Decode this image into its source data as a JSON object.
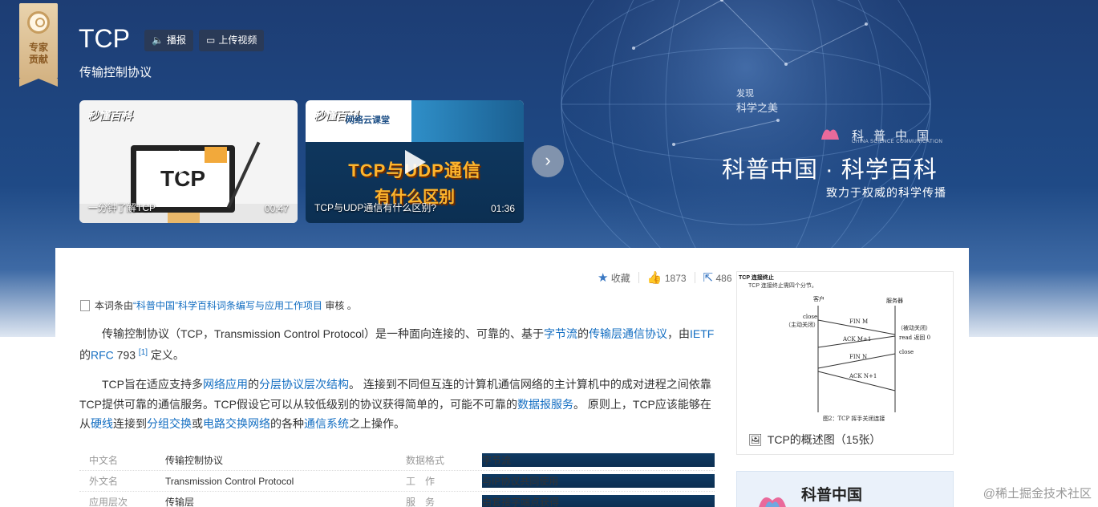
{
  "header": {
    "badge_line1": "专家",
    "badge_line2": "贡献",
    "title": "TCP",
    "play_label": "播报",
    "upload_label": "上传视频",
    "subtitle": "传输控制协议"
  },
  "videos": [
    {
      "brand": "秒懂百科",
      "screen_text": "TCP",
      "caption": "一分钟了解TCP",
      "duration": "00:47"
    },
    {
      "brand": "秒懂百科",
      "sub_brand": "网络云课堂",
      "overlay_line1": "TCP与UDP通信",
      "overlay_line2": "有什么区别",
      "caption": "TCP与UDP通信有什么区别?",
      "duration": "01:36"
    }
  ],
  "promo_banner": {
    "tag1": "发现",
    "tag2": "科学之美",
    "logo_cn": "科普中国",
    "logo_en": "CHINA SCIENCE COMMUNICATION",
    "main": "科普中国 · 科学百科",
    "sub": "致力于权威的科学传播"
  },
  "actions": {
    "collect_label": "收藏",
    "likes": "1873",
    "shares": "486"
  },
  "notice": {
    "prefix": "本词条由",
    "link": "“科普中国”科学百科词条编写与应用工作项目",
    "suffix": "审核 。"
  },
  "paragraphs": {
    "p1_a": "传输控制协议（TCP，Transmission Control Protocol）是一种面向连接的、可靠的、基于",
    "p1_link1": "字节流",
    "p1_b": "的",
    "p1_link2": "传输层通信协议",
    "p1_c": "，由",
    "p1_link3": "IETF",
    "p1_d": "的",
    "p1_link4": "RFC",
    "p1_e": " 793 ",
    "p1_ref": "[1]",
    "p1_f": " 定义。",
    "p2_a": "TCP旨在适应支持多",
    "p2_link1": "网络应用",
    "p2_b": "的",
    "p2_link2": "分层协议层次结构",
    "p2_c": "。 连接到不同但互连的计算机通信网络的主计算机中的成对进程之间依靠TCP提供可靠的通信服务。TCP假设它可以从较低级别的协议获得简单的，可能不可靠的",
    "p2_link3": "数据报服务",
    "p2_d": "。 原则上，TCP应该能够在从",
    "p2_link4": "硬线",
    "p2_e": "连接到",
    "p2_link5": "分组交换",
    "p2_f": "或",
    "p2_link6": "电路交换网络",
    "p2_g": "的各种",
    "p2_link7": "通信系统",
    "p2_h": "之上操作。"
  },
  "info_rows": [
    {
      "k": "中文名",
      "v": "传输控制协议",
      "k2": "数据格式",
      "v2": "字节流"
    },
    {
      "k": "外文名",
      "v": "Transmission Control Protocol",
      "k2": "工　作",
      "v2": "与IP协议共同使用"
    },
    {
      "k": "应用层次",
      "v": "传输层",
      "k2": "服　务",
      "v2": "由套接字端点获得"
    }
  ],
  "figure": {
    "title": "TCP 连接终止",
    "desc": "TCP 连接终止需四个分节。",
    "client": "客户",
    "server": "服务器",
    "fin_m": "FIN M",
    "ack_m1": "ACK M+1",
    "fin_n": "FIN N",
    "ack_n1": "ACK N+1",
    "close": "close",
    "active_close": "（主动关闭）",
    "passive_close": "（被动关闭）",
    "read_returns": "read 返回 0",
    "close2": "close",
    "fig_caption": "图2：TCP 挥手关闭连接",
    "caption": "TCP的概述图（15张）"
  },
  "promo_card": {
    "name": "科普中国"
  },
  "watermark": "@稀土掘金技术社区"
}
